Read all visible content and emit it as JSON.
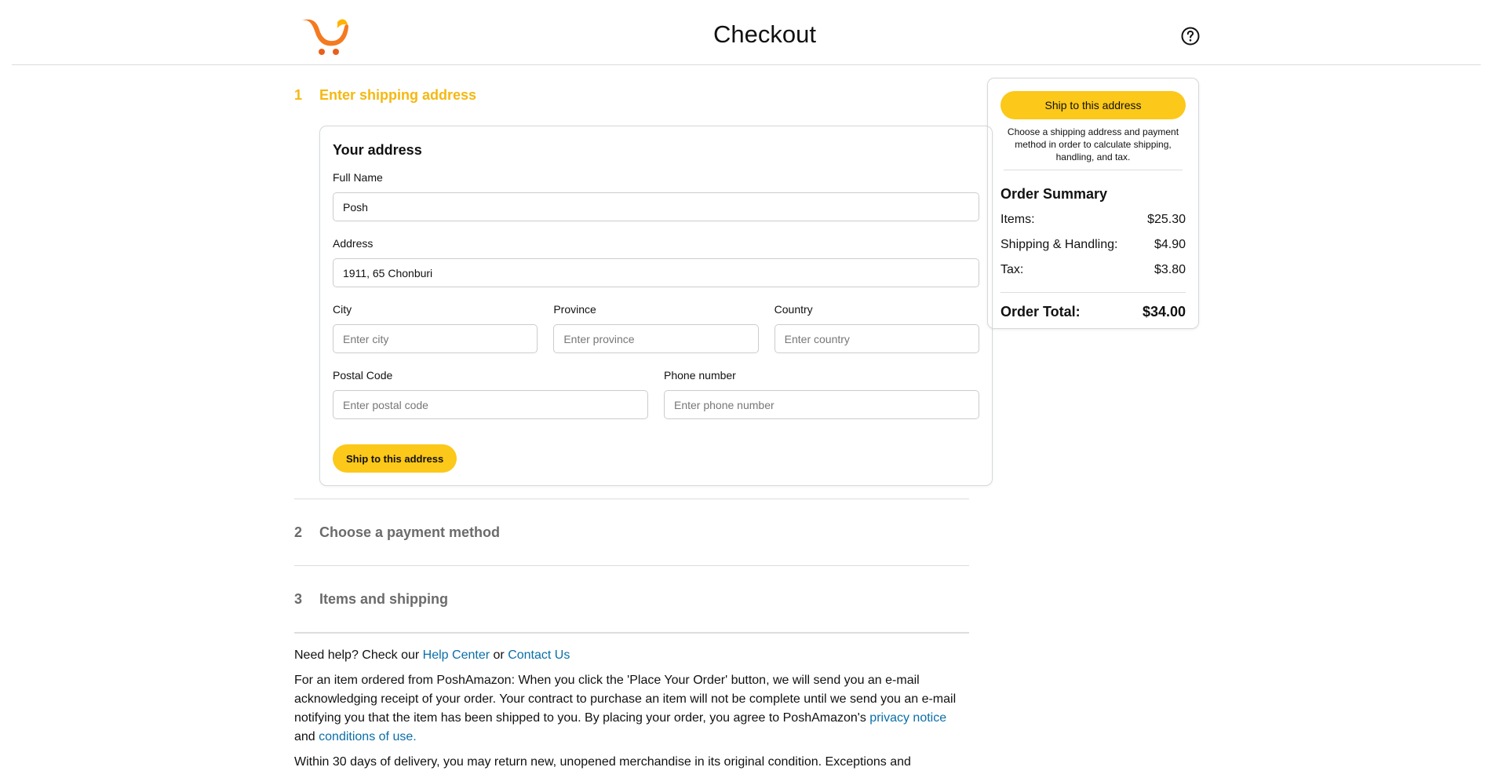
{
  "header": {
    "title": "Checkout",
    "help_icon": "question-circle-icon",
    "logo_icon": "cart-logo-icon"
  },
  "steps": [
    {
      "number": "1",
      "title": "Enter shipping address"
    },
    {
      "number": "2",
      "title": "Choose a payment method"
    },
    {
      "number": "3",
      "title": "Items and shipping"
    }
  ],
  "address_form": {
    "title": "Your address",
    "full_name": {
      "label": "Full Name",
      "value": "Posh"
    },
    "address": {
      "label": "Address",
      "value": "1911, 65 Chonburi"
    },
    "city": {
      "label": "City",
      "placeholder": "Enter city"
    },
    "province": {
      "label": "Province",
      "placeholder": "Enter province"
    },
    "country": {
      "label": "Country",
      "placeholder": "Enter country"
    },
    "postal_code": {
      "label": "Postal Code",
      "placeholder": "Enter postal code"
    },
    "phone": {
      "label": "Phone number",
      "placeholder": "Enter phone number"
    },
    "submit_label": "Ship to this address"
  },
  "summary": {
    "button_label": "Ship to this address",
    "note": "Choose a shipping address and payment method in order to calculate shipping, handling, and tax.",
    "title": "Order Summary",
    "items_label": "Items:",
    "items_value": "$25.30",
    "shipping_label": "Shipping & Handling:",
    "shipping_value": "$4.90",
    "tax_label": "Tax:",
    "tax_value": "$3.80",
    "total_label": "Order Total:",
    "total_value": "$34.00"
  },
  "footer": {
    "help_prefix": "Need help? Check our",
    "help_center": "Help Center",
    "or": "or",
    "contact_us": "Contact Us",
    "legal_text": "For an item ordered from PoshAmazon: When you click the 'Place Your Order' button, we will send you an e-mail acknowledging receipt of your order. Your contract to purchase an item will not be complete until we send you an e-mail notifying you that the item has been shipped to you. By placing your order, you agree to PoshAmazon's",
    "privacy_notice": "privacy notice",
    "and": "and",
    "conditions_of_use": "conditions of use.",
    "return_text": "Within 30 days of delivery, you may return new, unopened merchandise in its original condition. Exceptions and"
  },
  "colors": {
    "accent": "#f5b811",
    "button": "#fcc819",
    "link": "#0a6ea8"
  }
}
